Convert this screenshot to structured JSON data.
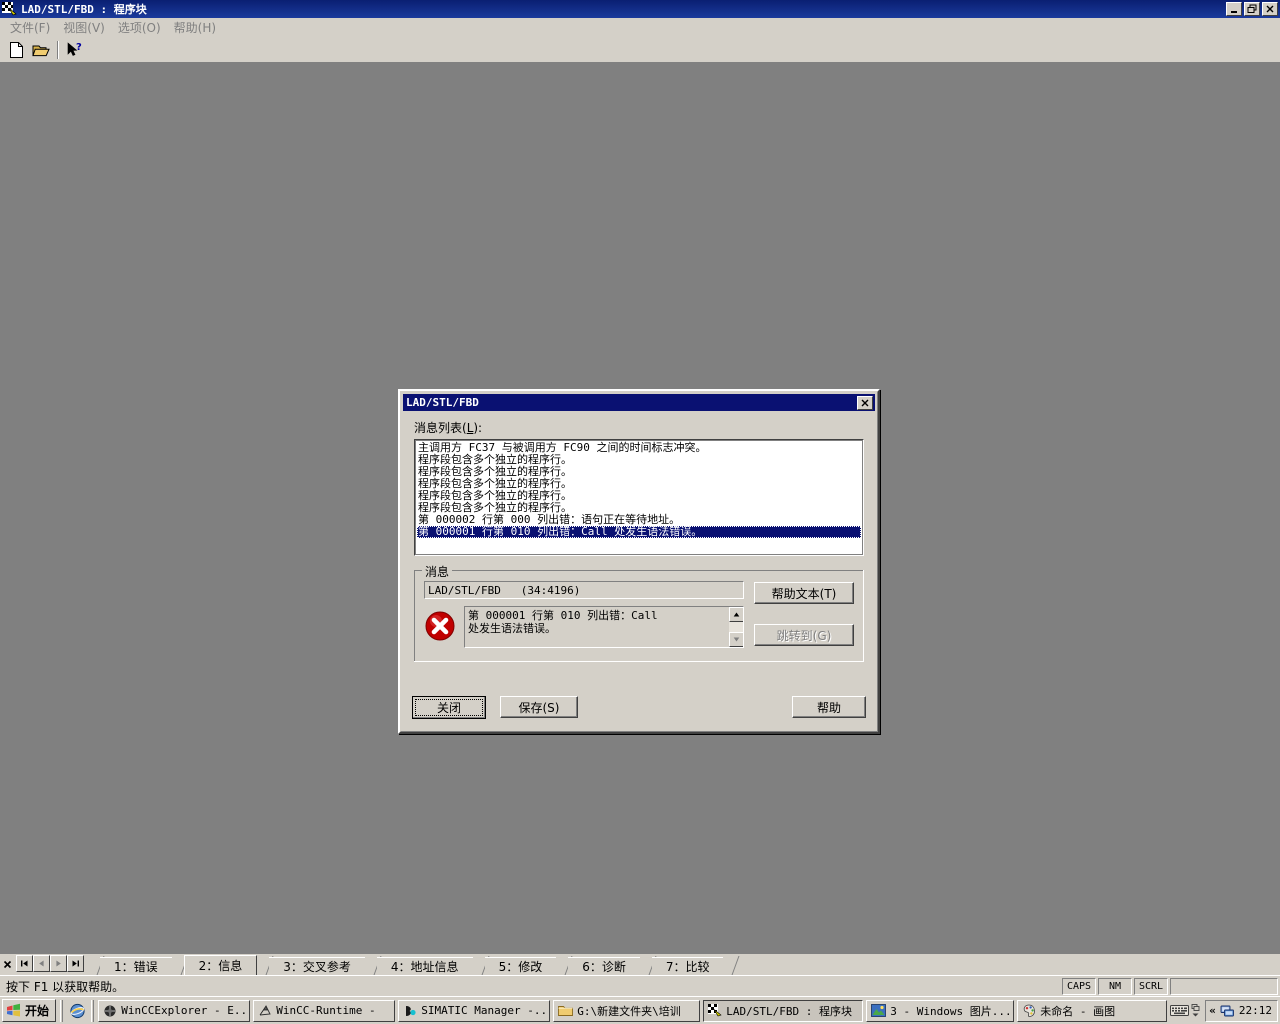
{
  "app": {
    "title": "LAD/STL/FBD : 程序块",
    "icon": "lad-stl-fbd-icon",
    "window_controls": [
      {
        "name": "minimize-button",
        "glyph": "_"
      },
      {
        "name": "restore-button",
        "glyph": "❐"
      },
      {
        "name": "close-button",
        "glyph": "✕"
      }
    ],
    "menu": [
      {
        "name": "menu-file",
        "label": "文件(F)"
      },
      {
        "name": "menu-view",
        "label": "视图(V)"
      },
      {
        "name": "menu-options",
        "label": "选项(O)"
      },
      {
        "name": "menu-help",
        "label": "帮助(H)"
      }
    ],
    "toolbar": [
      {
        "name": "new-document-icon",
        "tip": "新建"
      },
      {
        "name": "open-folder-icon",
        "tip": "打开"
      },
      {
        "name": "context-help-icon",
        "tip": "帮助"
      }
    ]
  },
  "dialog": {
    "title": "LAD/STL/FBD",
    "close_glyph": "✕",
    "list_label_prefix": "消息列表(",
    "list_label_key": "L",
    "list_label_suffix": "):",
    "messages": [
      {
        "text": "主调用方 FC37 与被调用方 FC90 之间的时间标志冲突。",
        "selected": false
      },
      {
        "text": "程序段包含多个独立的程序行。",
        "selected": false
      },
      {
        "text": "程序段包含多个独立的程序行。",
        "selected": false
      },
      {
        "text": "程序段包含多个独立的程序行。",
        "selected": false
      },
      {
        "text": "程序段包含多个独立的程序行。",
        "selected": false
      },
      {
        "text": "程序段包含多个独立的程序行。",
        "selected": false
      },
      {
        "text": "第 000002 行第 000 列出错：语句正在等待地址。",
        "selected": false
      },
      {
        "text": "第 000001 行第 010 列出错：Call 处发生语法错误。",
        "selected": true
      }
    ],
    "group": {
      "legend": "消息",
      "source": "LAD/STL/FBD   (34:4196)",
      "error_icon": "error-icon",
      "detail_text": "第 000001 行第 010 列出错：Call\n处发生语法错误。",
      "scroll_up_glyph": "▲",
      "scroll_down_glyph": "▼",
      "help_text_button": "帮助文本(T)",
      "goto_button": "跳转到(G)",
      "goto_disabled": true
    },
    "buttons": {
      "close": "关闭",
      "save": "保存(S)",
      "help": "帮助"
    }
  },
  "tabstrip": {
    "close_glyph": "✕",
    "navs": [
      {
        "name": "tab-nav-first",
        "glyph": "|◀"
      },
      {
        "name": "tab-nav-prev",
        "glyph": "◀"
      },
      {
        "name": "tab-nav-next",
        "glyph": "▶"
      },
      {
        "name": "tab-nav-last",
        "glyph": "▶|"
      }
    ],
    "tabs": [
      {
        "name": "tab-errors",
        "label": "1：错误",
        "active": false
      },
      {
        "name": "tab-info",
        "label": "2：信息",
        "active": true
      },
      {
        "name": "tab-cross-reference",
        "label": "3：交叉参考",
        "active": false
      },
      {
        "name": "tab-address-info",
        "label": "4：地址信息",
        "active": false
      },
      {
        "name": "tab-modify",
        "label": "5：修改",
        "active": false
      },
      {
        "name": "tab-diagnostics",
        "label": "6：诊断",
        "active": false
      },
      {
        "name": "tab-compare",
        "label": "7：比较",
        "active": false
      }
    ]
  },
  "statusbar": {
    "hint": "按下 F1 以获取帮助。",
    "indicators": [
      "CAPS",
      "NM",
      "SCRL"
    ]
  },
  "taskbar": {
    "start_label": "开始",
    "quicklaunch": [
      {
        "name": "quicklaunch-ie-icon"
      }
    ],
    "tasks": [
      {
        "name": "task-wincc-explorer",
        "label": "WinCCExplorer - E...",
        "icon": "wincc-icon",
        "active": false
      },
      {
        "name": "task-wincc-runtime",
        "label": "WinCC-Runtime -",
        "icon": "runtime-icon",
        "active": false
      },
      {
        "name": "task-simatic-manager",
        "label": "SIMATIC Manager -...",
        "icon": "simatic-icon",
        "active": false
      },
      {
        "name": "task-explorer-folder",
        "label": "G:\\新建文件夹\\培训",
        "icon": "folder-icon",
        "active": false
      },
      {
        "name": "task-lad-stl-fbd",
        "label": "LAD/STL/FBD : 程序块",
        "icon": "lad-icon",
        "active": true
      },
      {
        "name": "task-windows-picture-viewer",
        "label": "3 - Windows 图片...",
        "icon": "picture-icon",
        "active": false
      },
      {
        "name": "task-paint",
        "label": "未命名 - 画图",
        "icon": "paint-icon",
        "active": false
      }
    ],
    "ime_icon": "keyboard-icon",
    "tray": {
      "expand_glyph": "«",
      "network_icon": "network-icon",
      "clock": "22:12"
    }
  }
}
